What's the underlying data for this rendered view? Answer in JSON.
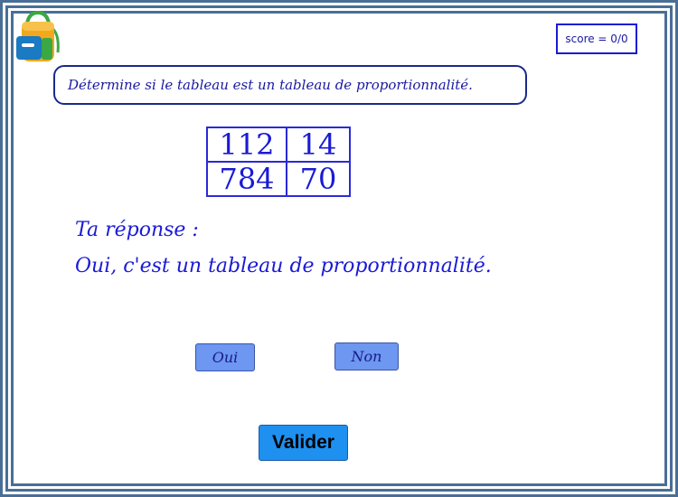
{
  "header": {
    "icon": "backpack-icon",
    "score_label": "score = 0/0"
  },
  "instruction": {
    "text": "Détermine si le tableau est un tableau de proportionnalité."
  },
  "table": {
    "rows": [
      [
        "112",
        "14"
      ],
      [
        "784",
        "70"
      ]
    ]
  },
  "answer": {
    "label": "Ta réponse :",
    "text": "Oui, c'est un tableau de proportionnalité."
  },
  "choices": {
    "oui_label": "Oui",
    "non_label": "Non"
  },
  "actions": {
    "validate_label": "Valider"
  },
  "colors": {
    "frame": "#4a6f96",
    "text_blue": "#1a1ad6",
    "choice_button": "#6d97f0",
    "validate_button": "#1e90f0"
  }
}
